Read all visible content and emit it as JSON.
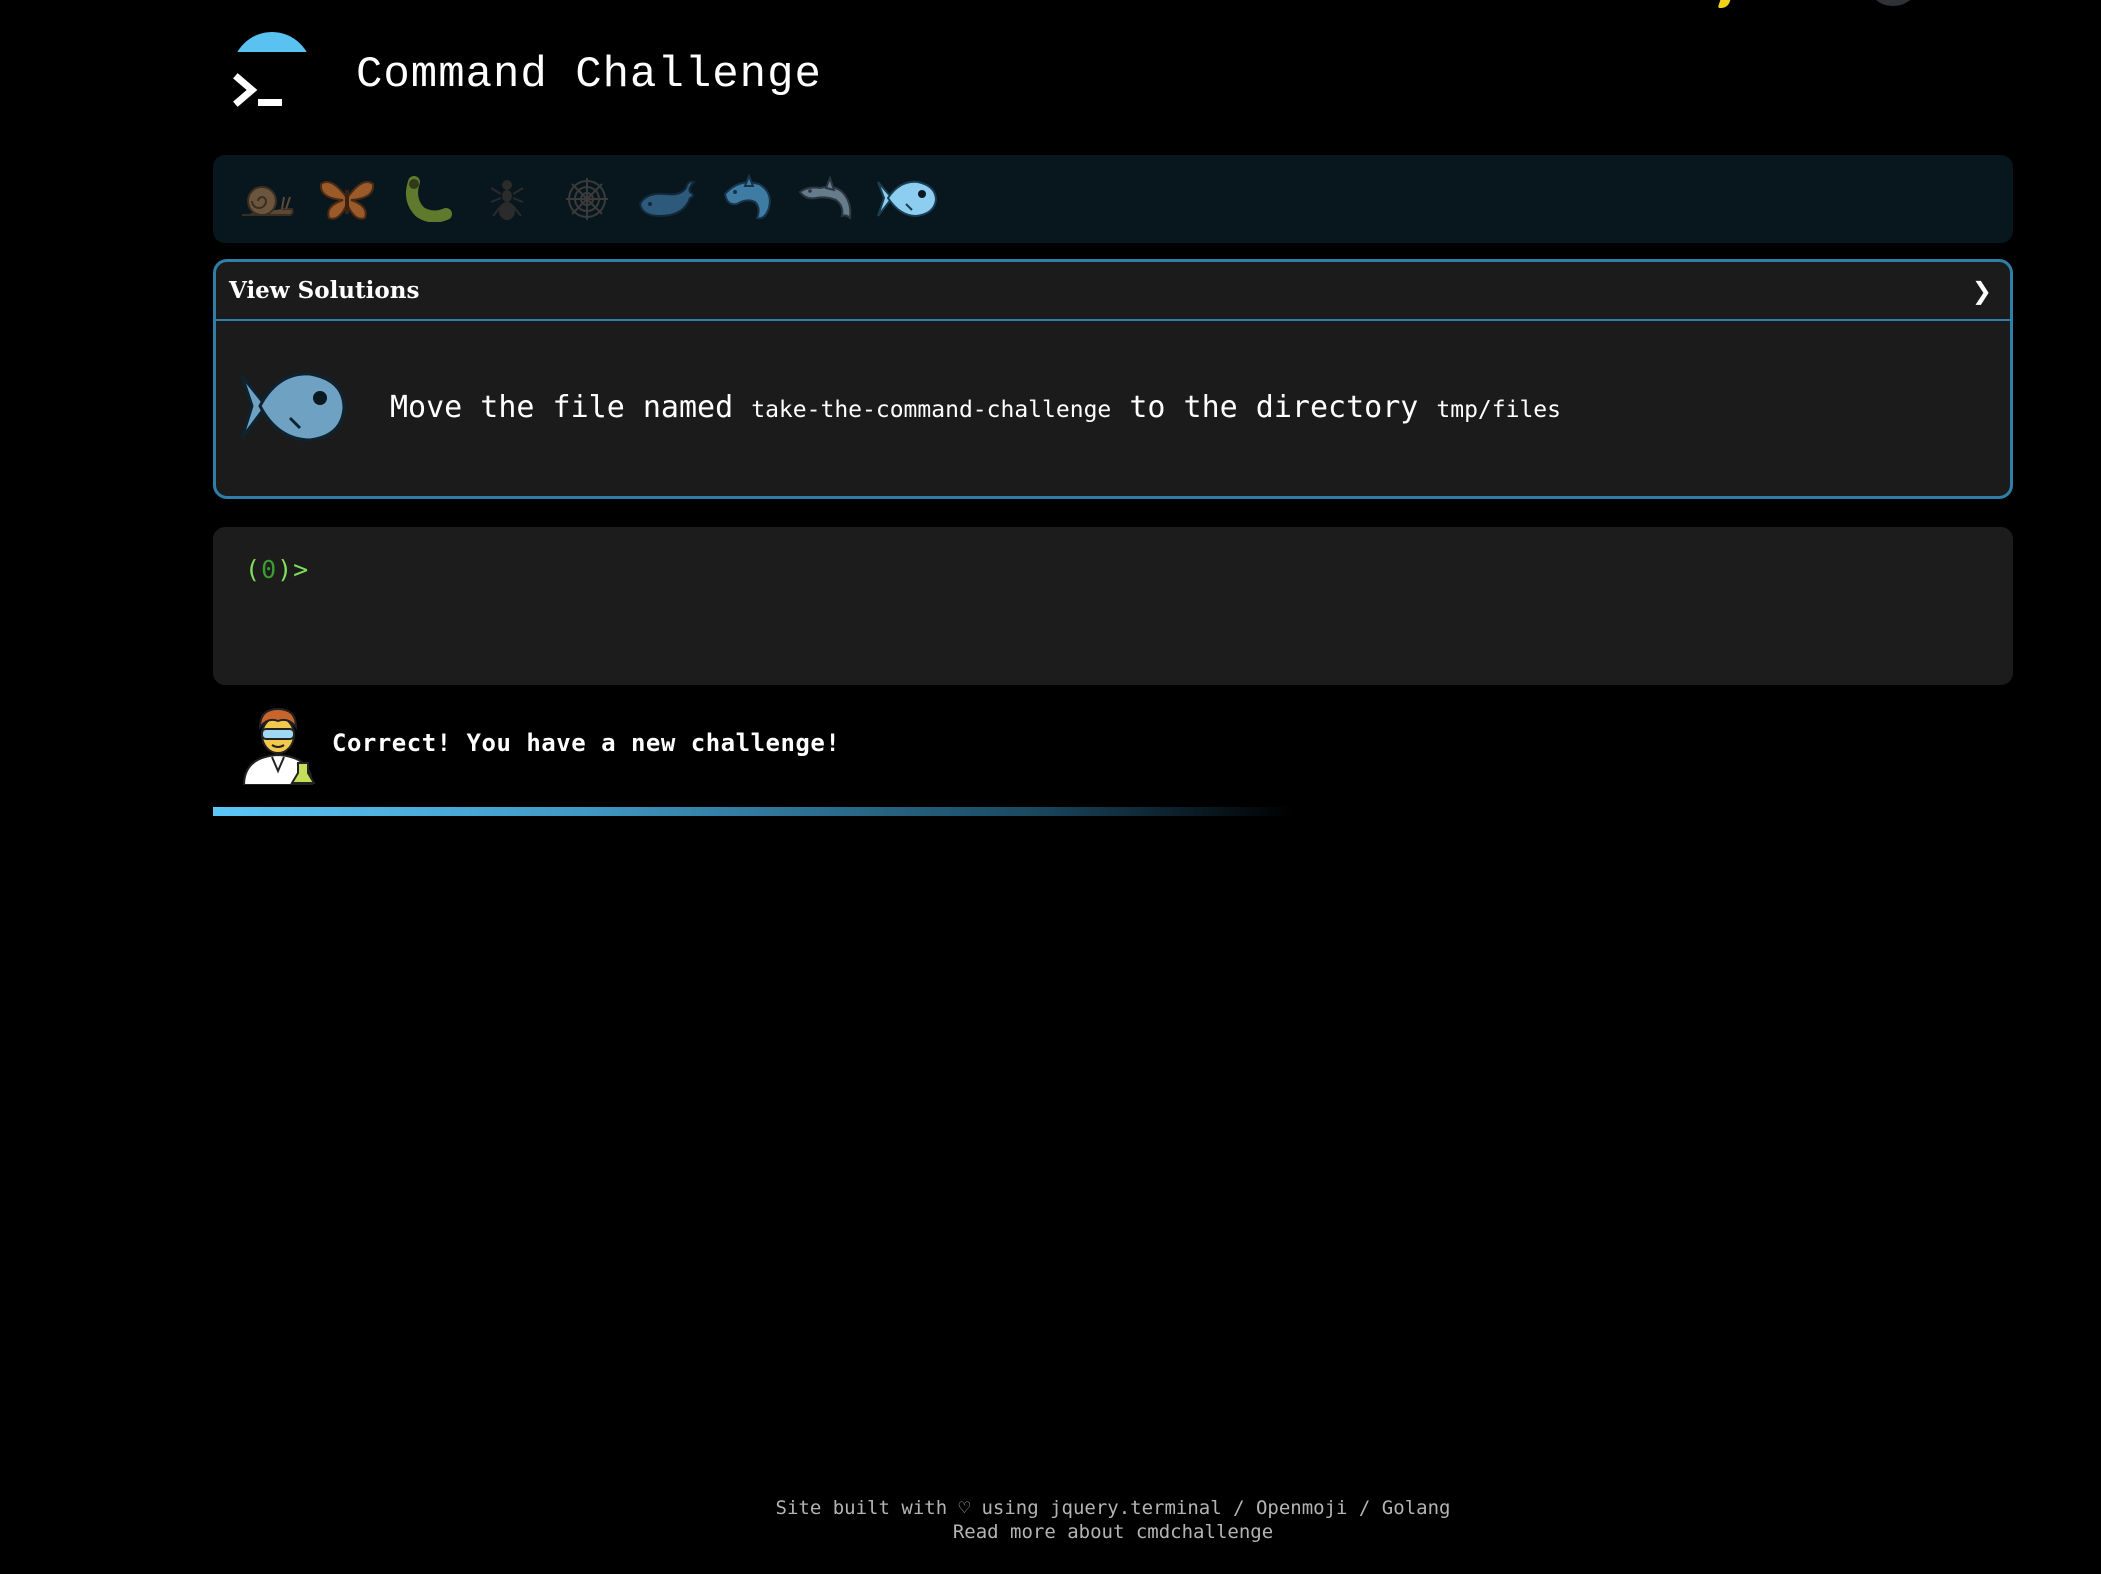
{
  "header": {
    "title": "Command Challenge"
  },
  "levels": [
    {
      "name": "snail",
      "icon": "snail-icon"
    },
    {
      "name": "butterfly",
      "icon": "butterfly-icon"
    },
    {
      "name": "caterpillar",
      "icon": "bug-icon"
    },
    {
      "name": "ant",
      "icon": "ant-icon"
    },
    {
      "name": "spider web",
      "icon": "spider-web-icon"
    },
    {
      "name": "whale",
      "icon": "whale-icon"
    },
    {
      "name": "shark",
      "icon": "shark-icon"
    },
    {
      "name": "dolphin",
      "icon": "dolphin-icon"
    },
    {
      "name": "fish (current)",
      "icon": "fish-icon"
    }
  ],
  "panel": {
    "header_label": "View Solutions",
    "chevron": "❯",
    "task": {
      "part1": "Move the file named",
      "file": "take-the-command-challenge",
      "part2": "to the directory",
      "dir": "tmp/files"
    }
  },
  "terminal": {
    "prompt_open": "(",
    "prompt_count": "0",
    "prompt_close": ")>"
  },
  "feedback": {
    "message": "Correct! You have a new challenge!"
  },
  "progress": {
    "fraction": 0.6
  },
  "footer": {
    "line1": "Site built with ♡ using jquery.terminal / Openmoji / Golang",
    "line2": "Read more about cmdchallenge"
  },
  "colors": {
    "accent": "#2f7fa8",
    "prompt": "#7ee05a",
    "progress": "#5cc7f7"
  }
}
